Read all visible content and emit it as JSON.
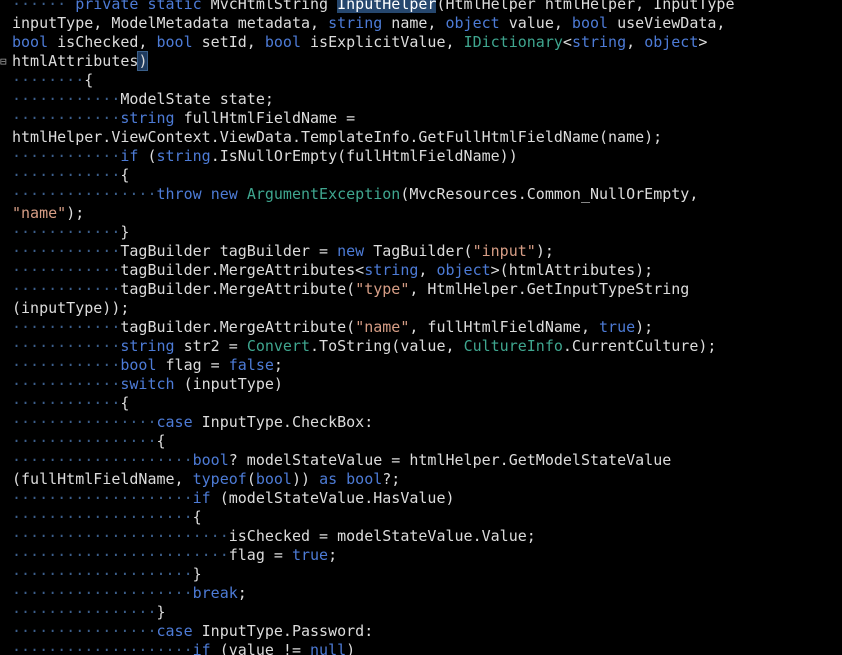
{
  "editor": {
    "lines": [
      [
        [
          "ws",
          "······"
        ],
        [
          "pl",
          " "
        ],
        [
          "kw",
          "private"
        ],
        [
          "pl",
          " "
        ],
        [
          "kw",
          "static"
        ],
        [
          "pl",
          " MvcHtmlString "
        ],
        [
          "hl",
          "InputHelper"
        ],
        [
          "pl",
          "(HtmlHelper htmlHelper, InputType"
        ]
      ],
      [
        [
          "pl",
          "inputType, ModelMetadata metadata, "
        ],
        [
          "kw",
          "string"
        ],
        [
          "pl",
          " name, "
        ],
        [
          "kw",
          "object"
        ],
        [
          "pl",
          " value, "
        ],
        [
          "kw",
          "bool"
        ],
        [
          "pl",
          " useViewData,"
        ]
      ],
      [
        [
          "kw",
          "bool"
        ],
        [
          "pl",
          " isChecked, "
        ],
        [
          "kw",
          "bool"
        ],
        [
          "pl",
          " setId, "
        ],
        [
          "kw",
          "bool"
        ],
        [
          "pl",
          " isExplicitValue, "
        ],
        [
          "tp",
          "IDictionary"
        ],
        [
          "pl",
          "<"
        ],
        [
          "kw",
          "string"
        ],
        [
          "pl",
          ", "
        ],
        [
          "kw",
          "object"
        ],
        [
          "pl",
          ">"
        ]
      ],
      [
        [
          "pl",
          "htmlAttributes"
        ],
        [
          "brace-hl",
          ")"
        ]
      ],
      [
        [
          "ws",
          "········"
        ],
        [
          "pl",
          "{"
        ]
      ],
      [
        [
          "ws",
          "············"
        ],
        [
          "pl",
          "ModelState state;"
        ]
      ],
      [
        [
          "ws",
          "············"
        ],
        [
          "kw",
          "string"
        ],
        [
          "pl",
          " fullHtmlFieldName = "
        ]
      ],
      [
        [
          "pl",
          "htmlHelper.ViewContext.ViewData.TemplateInfo.GetFullHtmlFieldName(name);"
        ]
      ],
      [
        [
          "ws",
          "············"
        ],
        [
          "kw",
          "if"
        ],
        [
          "pl",
          " ("
        ],
        [
          "kw",
          "string"
        ],
        [
          "pl",
          ".IsNullOrEmpty(fullHtmlFieldName))"
        ]
      ],
      [
        [
          "ws",
          "············"
        ],
        [
          "pl",
          "{"
        ]
      ],
      [
        [
          "ws",
          "················"
        ],
        [
          "kw",
          "throw"
        ],
        [
          "pl",
          " "
        ],
        [
          "kw",
          "new"
        ],
        [
          "pl",
          " "
        ],
        [
          "tp",
          "ArgumentException"
        ],
        [
          "pl",
          "(MvcResources.Common_NullOrEmpty,"
        ]
      ],
      [
        [
          "str",
          "\"name\""
        ],
        [
          "pl",
          ");"
        ]
      ],
      [
        [
          "ws",
          "············"
        ],
        [
          "pl",
          "}"
        ]
      ],
      [
        [
          "ws",
          "············"
        ],
        [
          "pl",
          "TagBuilder tagBuilder = "
        ],
        [
          "kw",
          "new"
        ],
        [
          "pl",
          " TagBuilder("
        ],
        [
          "str",
          "\"input\""
        ],
        [
          "pl",
          ");"
        ]
      ],
      [
        [
          "ws",
          "············"
        ],
        [
          "pl",
          "tagBuilder.MergeAttributes<"
        ],
        [
          "kw",
          "string"
        ],
        [
          "pl",
          ", "
        ],
        [
          "kw",
          "object"
        ],
        [
          "pl",
          ">(htmlAttributes);"
        ]
      ],
      [
        [
          "ws",
          "············"
        ],
        [
          "pl",
          "tagBuilder.MergeAttribute("
        ],
        [
          "str",
          "\"type\""
        ],
        [
          "pl",
          ", HtmlHelper.GetInputTypeString"
        ]
      ],
      [
        [
          "pl",
          "(inputType));"
        ]
      ],
      [
        [
          "ws",
          "············"
        ],
        [
          "pl",
          "tagBuilder.MergeAttribute("
        ],
        [
          "str",
          "\"name\""
        ],
        [
          "pl",
          ", fullHtmlFieldName, "
        ],
        [
          "kw",
          "true"
        ],
        [
          "pl",
          ");"
        ]
      ],
      [
        [
          "ws",
          "············"
        ],
        [
          "kw",
          "string"
        ],
        [
          "pl",
          " str2 = "
        ],
        [
          "tp",
          "Convert"
        ],
        [
          "pl",
          ".ToString(value, "
        ],
        [
          "tp",
          "CultureInfo"
        ],
        [
          "pl",
          ".CurrentCulture);"
        ]
      ],
      [
        [
          "ws",
          "············"
        ],
        [
          "kw",
          "bool"
        ],
        [
          "pl",
          " flag = "
        ],
        [
          "kw",
          "false"
        ],
        [
          "pl",
          ";"
        ]
      ],
      [
        [
          "ws",
          "············"
        ],
        [
          "kw",
          "switch"
        ],
        [
          "pl",
          " (inputType)"
        ]
      ],
      [
        [
          "ws",
          "············"
        ],
        [
          "pl",
          "{"
        ]
      ],
      [
        [
          "ws",
          "················"
        ],
        [
          "kw",
          "case"
        ],
        [
          "pl",
          " InputType.CheckBox:"
        ]
      ],
      [
        [
          "ws",
          "················"
        ],
        [
          "pl",
          "{"
        ]
      ],
      [
        [
          "ws",
          "····················"
        ],
        [
          "kw",
          "bool"
        ],
        [
          "pl",
          "? modelStateValue = htmlHelper.GetModelStateValue"
        ]
      ],
      [
        [
          "pl",
          "(fullHtmlFieldName, "
        ],
        [
          "kw",
          "typeof"
        ],
        [
          "pl",
          "("
        ],
        [
          "kw",
          "bool"
        ],
        [
          "pl",
          ")) "
        ],
        [
          "kw",
          "as"
        ],
        [
          "pl",
          " "
        ],
        [
          "kw",
          "bool"
        ],
        [
          "pl",
          "?;"
        ]
      ],
      [
        [
          "ws",
          "····················"
        ],
        [
          "kw",
          "if"
        ],
        [
          "pl",
          " (modelStateValue.HasValue)"
        ]
      ],
      [
        [
          "ws",
          "····················"
        ],
        [
          "pl",
          "{"
        ]
      ],
      [
        [
          "ws",
          "························"
        ],
        [
          "pl",
          "isChecked = modelStateValue.Value;"
        ]
      ],
      [
        [
          "ws",
          "························"
        ],
        [
          "pl",
          "flag = "
        ],
        [
          "kw",
          "true"
        ],
        [
          "pl",
          ";"
        ]
      ],
      [
        [
          "ws",
          "····················"
        ],
        [
          "pl",
          "}"
        ]
      ],
      [
        [
          "ws",
          "····················"
        ],
        [
          "kw",
          "break"
        ],
        [
          "pl",
          ";"
        ]
      ],
      [
        [
          "ws",
          "················"
        ],
        [
          "pl",
          "}"
        ]
      ],
      [
        [
          "ws",
          "················"
        ],
        [
          "kw",
          "case"
        ],
        [
          "pl",
          " InputType.Password:"
        ]
      ],
      [
        [
          "ws",
          "····················"
        ],
        [
          "kw",
          "if"
        ],
        [
          "pl",
          " (value != "
        ],
        [
          "kw",
          "null"
        ],
        [
          "pl",
          ")"
        ]
      ]
    ],
    "fold_line_index": 3,
    "fold_symbol": "⊟"
  },
  "colors": {
    "background": "#000000",
    "keyword": "#4d7bd6",
    "type": "#3fa68f",
    "string": "#d69d85",
    "plain": "#dcdcdc",
    "whitespace_dots": "#3c5f8c",
    "selection": "#26476e"
  }
}
